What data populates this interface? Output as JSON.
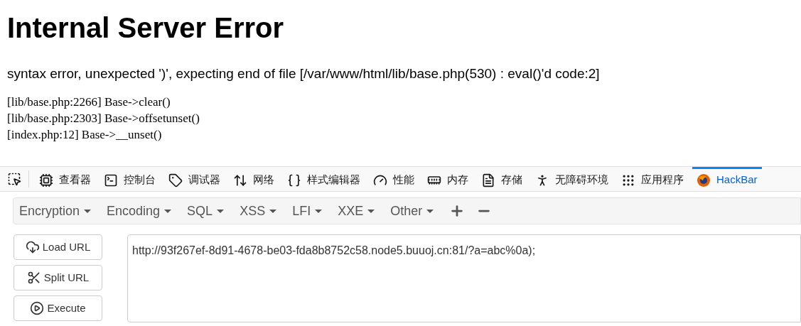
{
  "page": {
    "title": "Internal Server Error",
    "message": "syntax error, unexpected ')', expecting end of file [/var/www/html/lib/base.php(530) : eval()'d code:2]",
    "trace": [
      "[lib/base.php:2266] Base->clear()",
      "[lib/base.php:2303] Base->offsetunset()",
      "[index.php:12] Base->__unset()"
    ]
  },
  "devtools": {
    "tabs": [
      {
        "kind": "inspector",
        "label": "查看器",
        "selected": false
      },
      {
        "kind": "console",
        "label": "控制台",
        "selected": false
      },
      {
        "kind": "debugger",
        "label": "调试器",
        "selected": false
      },
      {
        "kind": "network",
        "label": "网络",
        "selected": false
      },
      {
        "kind": "style",
        "label": "样式编辑器",
        "selected": false
      },
      {
        "kind": "performance",
        "label": "性能",
        "selected": false
      },
      {
        "kind": "memory",
        "label": "内存",
        "selected": false
      },
      {
        "kind": "storage",
        "label": "存储",
        "selected": false
      },
      {
        "kind": "accessibility",
        "label": "无障碍环境",
        "selected": false
      },
      {
        "kind": "application",
        "label": "应用程序",
        "selected": false
      },
      {
        "kind": "hackbar",
        "label": "HackBar",
        "selected": true
      }
    ]
  },
  "hackbar": {
    "menus": [
      "Encryption",
      "Encoding",
      "SQL",
      "XSS",
      "LFI",
      "XXE",
      "Other"
    ],
    "buttons": [
      {
        "kind": "load",
        "label": "Load URL"
      },
      {
        "kind": "split",
        "label": "Split URL"
      },
      {
        "kind": "execute",
        "label": "Execute"
      }
    ],
    "url": "http://93f267ef-8d91-4678-be03-fda8b8752c58.node5.buuoj.cn:81/?a=abc%0a);"
  }
}
